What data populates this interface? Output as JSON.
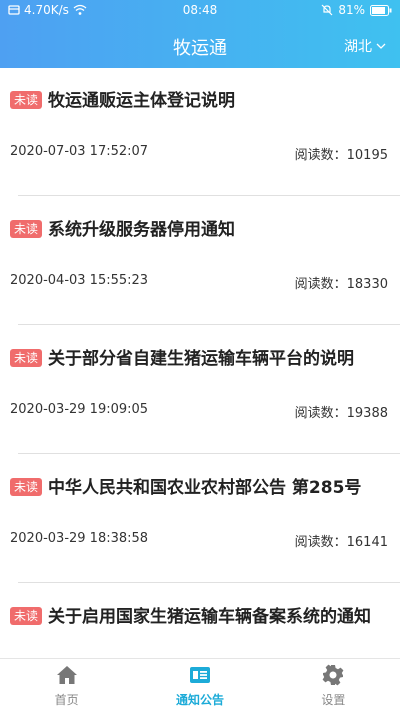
{
  "status_bar": {
    "speed": "4.70K/s",
    "time": "08:48",
    "battery": "81%"
  },
  "header": {
    "title": "牧运通",
    "region": "湖北"
  },
  "badge_label": "未读",
  "read_prefix": "阅读数：",
  "articles": [
    {
      "title": "牧运通贩运主体登记说明",
      "date": "2020-07-03 17:52:07",
      "reads": "10195"
    },
    {
      "title": "系统升级服务器停用通知",
      "date": "2020-04-03 15:55:23",
      "reads": "18330"
    },
    {
      "title": "关于部分省自建生猪运输车辆平台的说明",
      "date": "2020-03-29 19:09:05",
      "reads": "19388"
    },
    {
      "title": "中华人民共和国农业农村部公告 第285号",
      "date": "2020-03-29 18:38:58",
      "reads": "16141"
    },
    {
      "title": "关于启用国家生猪运输车辆备案系统的通知",
      "date": "",
      "reads": ""
    }
  ],
  "tabs": [
    {
      "label": "首页",
      "icon": "home-icon"
    },
    {
      "label": "通知公告",
      "icon": "notice-icon"
    },
    {
      "label": "设置",
      "icon": "gear-icon"
    }
  ],
  "colors": {
    "header_start": "#4ea0f2",
    "header_end": "#3fc1f0",
    "badge": "#f06c6c",
    "tab_active": "#1dabd8",
    "tab_inactive": "#888888"
  }
}
